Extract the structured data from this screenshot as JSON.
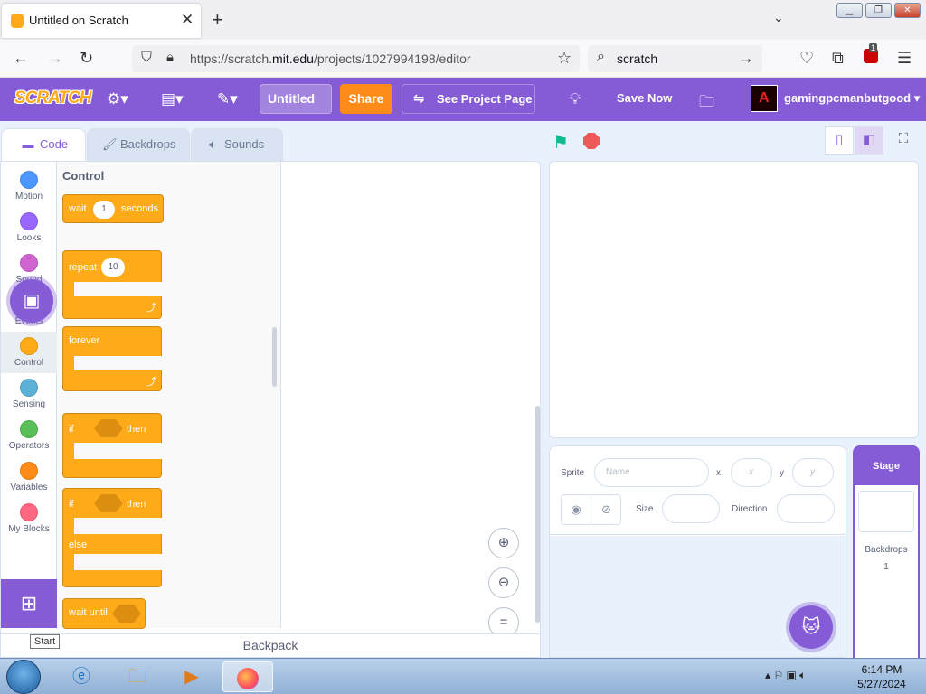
{
  "browser": {
    "tab_title": "Untitled on Scratch",
    "url_prefix": "https://scratch.",
    "url_domain": "mit.edu",
    "url_path": "/projects/1027994198/editor",
    "search_text": "scratch",
    "extension_badge": "1"
  },
  "menubar": {
    "logo": "SCRATCH",
    "project_title": "Untitled",
    "share_label": "Share",
    "see_project_page_label": "See Project Page",
    "save_now_label": "Save Now",
    "username": "gamingpcmanbutgood"
  },
  "editor_tabs": [
    {
      "label": "Code"
    },
    {
      "label": "Backdrops"
    },
    {
      "label": "Sounds"
    }
  ],
  "categories": [
    {
      "label": "Motion",
      "color": "#4c97ff"
    },
    {
      "label": "Looks",
      "color": "#9966ff"
    },
    {
      "label": "Sound",
      "color": "#cf63cf"
    },
    {
      "label": "Events",
      "color": "#ffbf00"
    },
    {
      "label": "Control",
      "color": "#ffab19"
    },
    {
      "label": "Sensing",
      "color": "#5cb1d6"
    },
    {
      "label": "Operators",
      "color": "#59c059"
    },
    {
      "label": "Variables",
      "color": "#ff8c1a"
    },
    {
      "label": "My Blocks",
      "color": "#ff6680"
    }
  ],
  "flyout": {
    "title": "Control",
    "wait": {
      "label": "wait",
      "value": "1",
      "unit": "seconds"
    },
    "repeat": {
      "label": "repeat",
      "value": "10"
    },
    "forever": {
      "label": "forever"
    },
    "if_then": {
      "if_label": "if",
      "then_label": "then"
    },
    "if_else": {
      "if_label": "if",
      "then_label": "then",
      "else_label": "else"
    },
    "wait_until": {
      "label": "wait until"
    }
  },
  "backpack_label": "Backpack",
  "tooltip": "Start",
  "sprite_info": {
    "sprite_label": "Sprite",
    "name_placeholder": "Name",
    "x_label": "x",
    "x_placeholder": "x",
    "y_label": "y",
    "y_placeholder": "y",
    "size_label": "Size",
    "direction_label": "Direction"
  },
  "stage_pane": {
    "header": "Stage",
    "backdrops_label": "Backdrops",
    "backdrops_count": "1"
  },
  "taskbar": {
    "time": "6:14 PM",
    "date": "5/27/2024"
  }
}
